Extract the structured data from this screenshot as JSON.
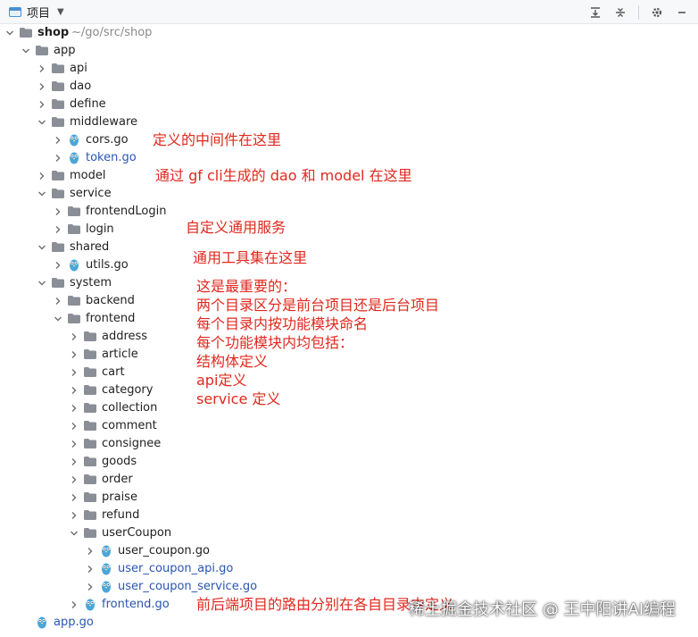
{
  "toolbar": {
    "title": "项目",
    "dropdown_icon": "chevron-down-icon",
    "actions": [
      "expand-all-icon",
      "collapse-all-icon",
      "gear-icon",
      "minimize-icon"
    ]
  },
  "tree": {
    "root": {
      "name": "shop",
      "path": "~/go/src/shop"
    },
    "items": [
      {
        "name": "app",
        "kind": "folder",
        "depth": 1,
        "expanded": true
      },
      {
        "name": "api",
        "kind": "folder",
        "depth": 2,
        "expanded": false
      },
      {
        "name": "dao",
        "kind": "folder",
        "depth": 2,
        "expanded": false
      },
      {
        "name": "define",
        "kind": "folder",
        "depth": 2,
        "expanded": false
      },
      {
        "name": "middleware",
        "kind": "folder",
        "depth": 2,
        "expanded": true
      },
      {
        "name": "cors.go",
        "kind": "gofile",
        "depth": 3,
        "expanded": false,
        "highlight": false
      },
      {
        "name": "token.go",
        "kind": "gofile",
        "depth": 3,
        "expanded": false,
        "highlight": true
      },
      {
        "name": "model",
        "kind": "folder",
        "depth": 2,
        "expanded": false
      },
      {
        "name": "service",
        "kind": "folder",
        "depth": 2,
        "expanded": true
      },
      {
        "name": "frontendLogin",
        "kind": "folder",
        "depth": 3,
        "expanded": false
      },
      {
        "name": "login",
        "kind": "folder",
        "depth": 3,
        "expanded": false
      },
      {
        "name": "shared",
        "kind": "folder",
        "depth": 2,
        "expanded": true
      },
      {
        "name": "utils.go",
        "kind": "gofile",
        "depth": 3,
        "expanded": false,
        "highlight": false
      },
      {
        "name": "system",
        "kind": "folder",
        "depth": 2,
        "expanded": true
      },
      {
        "name": "backend",
        "kind": "folder",
        "depth": 3,
        "expanded": false
      },
      {
        "name": "frontend",
        "kind": "folder",
        "depth": 3,
        "expanded": true
      },
      {
        "name": "address",
        "kind": "folder",
        "depth": 4,
        "expanded": false
      },
      {
        "name": "article",
        "kind": "folder",
        "depth": 4,
        "expanded": false
      },
      {
        "name": "cart",
        "kind": "folder",
        "depth": 4,
        "expanded": false
      },
      {
        "name": "category",
        "kind": "folder",
        "depth": 4,
        "expanded": false
      },
      {
        "name": "collection",
        "kind": "folder",
        "depth": 4,
        "expanded": false
      },
      {
        "name": "comment",
        "kind": "folder",
        "depth": 4,
        "expanded": false
      },
      {
        "name": "consignee",
        "kind": "folder",
        "depth": 4,
        "expanded": false
      },
      {
        "name": "goods",
        "kind": "folder",
        "depth": 4,
        "expanded": false
      },
      {
        "name": "order",
        "kind": "folder",
        "depth": 4,
        "expanded": false
      },
      {
        "name": "praise",
        "kind": "folder",
        "depth": 4,
        "expanded": false
      },
      {
        "name": "refund",
        "kind": "folder",
        "depth": 4,
        "expanded": false
      },
      {
        "name": "userCoupon",
        "kind": "folder",
        "depth": 4,
        "expanded": true
      },
      {
        "name": "user_coupon.go",
        "kind": "gofile",
        "depth": 5,
        "expanded": false,
        "highlight": false
      },
      {
        "name": "user_coupon_api.go",
        "kind": "gofile",
        "depth": 5,
        "expanded": false,
        "highlight": true
      },
      {
        "name": "user_coupon_service.go",
        "kind": "gofile",
        "depth": 5,
        "expanded": false,
        "highlight": true
      },
      {
        "name": "frontend.go",
        "kind": "gofile",
        "depth": 4,
        "expanded": false,
        "highlight": true
      },
      {
        "name": "app.go",
        "kind": "gofile",
        "depth": 1,
        "expanded": false,
        "highlight": true,
        "leaf": true
      }
    ]
  },
  "annotations": {
    "middleware": "定义的中间件在这里",
    "model": "通过 gf cli生成的 dao 和 model 在这里",
    "service": "自定义通用服务",
    "shared": "通用工具集在这里",
    "system_lines": [
      "这是最重要的：",
      "两个目录区分是前台项目还是后台项目",
      "每个目录内按功能模块命名",
      "每个功能模块内均包括：",
      "结构体定义",
      "api定义",
      "service 定义"
    ],
    "frontend_go": "前后端项目的路由分别在各自目录中定义"
  },
  "watermark": "稀土掘金技术社区 @ 王中阳讲AI编程",
  "colors": {
    "annotation": "#e0281e",
    "folder": "#8a8e96",
    "gofile": "#4aa6d6",
    "highlight_text": "#2a55b0"
  }
}
